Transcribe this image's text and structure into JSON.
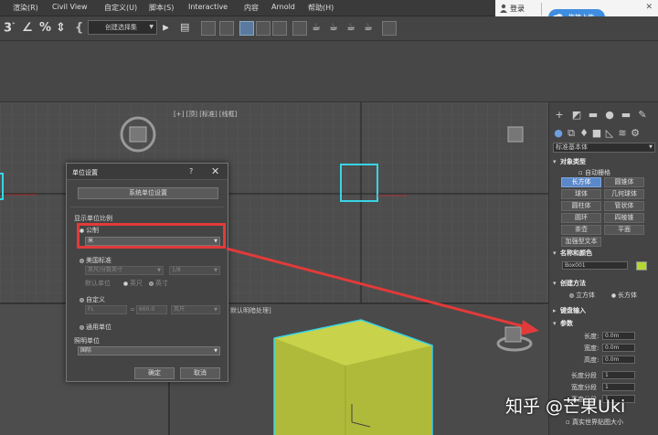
{
  "menu": {
    "items": [
      "渲染(R)",
      "Civil View",
      "自定义(U)",
      "脚本(S)",
      "Interactive",
      "内容",
      "Arnold",
      "帮助(H)"
    ]
  },
  "login": {
    "label": "登录",
    "upload_label": "拖拽上传"
  },
  "toolbar": {
    "selection_set": "创建选择集"
  },
  "viewport": {
    "top_left_label": "[+] [顶] [标准] [线框]",
    "perspective_label": "默认明暗处理]"
  },
  "dialog": {
    "title": "单位设置",
    "help": "?",
    "close": "✕",
    "system_units_button": "系统单位设置",
    "display_scale_label": "显示单位比例",
    "metric_label": "公制",
    "metric_value": "米",
    "us_standard_label": "美国标准",
    "us_standard_value": "英尺/分数英寸",
    "us_fraction_value": "1/8",
    "default_units_label": "默认单位",
    "feet_label": "英尺",
    "inches_label": "英寸",
    "custom_label": "自定义",
    "custom_name": "FL",
    "custom_equals": "=",
    "custom_value": "660.0",
    "custom_unit": "英尺",
    "generic_label": "通用单位",
    "lighting_units_label": "照明单位",
    "lighting_units_value": "国际",
    "ok_label": "确定",
    "cancel_label": "取消"
  },
  "command_panel": {
    "category": "标准基本体",
    "object_type_header": "对象类型",
    "autogrid_label": "自动栅格",
    "object_buttons": [
      "长方体",
      "圆锥体",
      "球体",
      "几何球体",
      "圆柱体",
      "管状体",
      "圆环",
      "四棱锥",
      "茶壶",
      "平面",
      "加强型文本"
    ],
    "name_color_header": "名称和颜色",
    "object_name": "Box001",
    "object_color": "#b4d832",
    "creation_method_header": "创建方法",
    "cube_label": "立方体",
    "box_label": "长方体",
    "keyboard_entry_header": "键盘输入",
    "parameters_header": "参数",
    "length_label": "长度:",
    "length_value": "0.0m",
    "width_label": "宽度:",
    "width_value": "0.0m",
    "height_label": "高度:",
    "height_value": "0.0m",
    "length_segs_label": "长度分段",
    "length_segs_value": "1",
    "width_segs_label": "宽度分段",
    "width_segs_value": "1",
    "height_segs_label": "高度分段",
    "height_segs_value": "1",
    "real_world_label": "真实世界贴图大小"
  },
  "watermark": "知乎 @芒果Uki",
  "colors": {
    "highlight": "#e23a3a",
    "selection_cyan": "#39d4e6",
    "box_yellow": "#b0ba3a",
    "active_blue": "#5b88c9"
  }
}
